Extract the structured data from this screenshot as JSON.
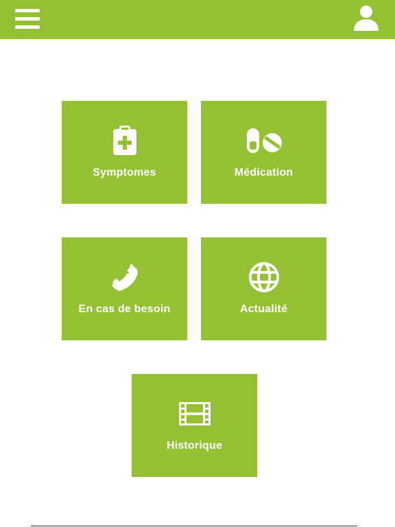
{
  "header": {
    "menu_icon": "hamburger-menu-icon",
    "user_icon": "user-profile-icon",
    "bar_color": "#93c133"
  },
  "tiles": [
    {
      "label": "Symptomes",
      "icon": "clipboard-medical-icon"
    },
    {
      "label": "Médication",
      "icon": "pills-icon"
    },
    {
      "label": "En cas de besoin",
      "icon": "phone-icon"
    },
    {
      "label": "Actualité",
      "icon": "globe-icon"
    },
    {
      "label": "Historique",
      "icon": "film-icon"
    }
  ],
  "colors": {
    "accent": "#93c133",
    "text_on_accent": "#ffffff",
    "background": "#ffffff"
  }
}
